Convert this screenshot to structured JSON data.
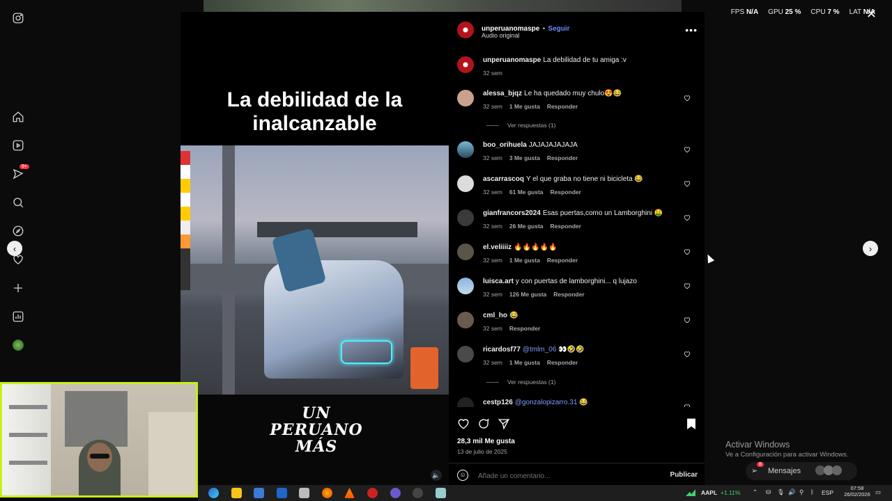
{
  "sidebar": {
    "items": [
      {
        "icon": "instagram-icon"
      },
      {
        "icon": "home-icon"
      },
      {
        "icon": "reels-icon"
      },
      {
        "icon": "messages-icon",
        "badge": "9+"
      },
      {
        "icon": "search-icon"
      },
      {
        "icon": "explore-icon"
      },
      {
        "icon": "notifications-icon"
      },
      {
        "icon": "create-icon"
      },
      {
        "icon": "dashboard-icon"
      },
      {
        "icon": "profile-icon"
      }
    ]
  },
  "overlay_stats": {
    "fps_label": "FPS",
    "fps_value": "N/A",
    "gpu_label": "GPU",
    "gpu_value": "25 %",
    "cpu_label": "CPU",
    "cpu_value": "7 %",
    "lat_label": "LAT",
    "lat_value": "N/A"
  },
  "video": {
    "title_line1": "La debilidad de la",
    "title_line2": "inalcanzable",
    "logo_line1": "UN",
    "logo_line2": "PERUANO",
    "logo_line3": "MÁS"
  },
  "post": {
    "author": "unperuanomaspe",
    "separator": "•",
    "follow": "Seguir",
    "audio": "Audio original",
    "caption_user": "unperuanomaspe",
    "caption_text": "La debilidad de tu amiga :v",
    "caption_time": "32 sem",
    "likes": "28,3 mil Me gusta",
    "date": "13 de julio de 2025",
    "add_comment_placeholder": "Añade un comentario...",
    "publish": "Publicar"
  },
  "comments": [
    {
      "user": "alessa_bjqz",
      "text": "Le ha quedado muy chulo😍😂",
      "time": "32 sem",
      "likes": "1 Me gusta",
      "reply": "Responder",
      "replies": "Ver respuestas (1)"
    },
    {
      "user": "boo_orihuela",
      "text": "JAJAJAJAJAJA",
      "time": "32 sem",
      "likes": "3 Me gusta",
      "reply": "Responder"
    },
    {
      "user": "ascarrascoq",
      "text": "Y el que graba no tiene ni bicicleta 😂",
      "time": "32 sem",
      "likes": "61 Me gusta",
      "reply": "Responder"
    },
    {
      "user": "gianfrancors2024",
      "text": "Esas puertas,como un Lamborghini 🤑",
      "time": "32 sem",
      "likes": "26 Me gusta",
      "reply": "Responder"
    },
    {
      "user": "el.veliiiiz",
      "text": "🔥🔥🔥🔥🔥",
      "time": "32 sem",
      "likes": "1 Me gusta",
      "reply": "Responder"
    },
    {
      "user": "luisca.art",
      "text": "y con puertas de lamborghini... q lujazo",
      "time": "32 sem",
      "likes": "126 Me gusta",
      "reply": "Responder"
    },
    {
      "user": "cml_ho",
      "text": "😂",
      "time": "32 sem",
      "likes": "",
      "reply": "Responder"
    },
    {
      "user": "ricardosf77",
      "mention": "@tmlm_06",
      "text": "👀🤣🤣",
      "time": "32 sem",
      "likes": "1 Me gusta",
      "reply": "Responder",
      "replies": "Ver respuestas (1)"
    },
    {
      "user": "cestp126",
      "mention": "@gonzalopizarro.31",
      "text": "😂"
    }
  ],
  "watermark": {
    "line1": "Activar Windows",
    "line2": "Ve a Configuración para activar Windows."
  },
  "messages_pill": {
    "label": "Mensajes",
    "badge": "8"
  },
  "taskbar": {
    "stock_ticker": "AAPL",
    "stock_change": "+1.11%",
    "lang": "ESP",
    "time": "07:58",
    "date": "26/02/2026"
  },
  "colors": {
    "accent": "#6d8cff",
    "webcam_border": "#c6f01a",
    "stock_green": "#3fd16a"
  }
}
